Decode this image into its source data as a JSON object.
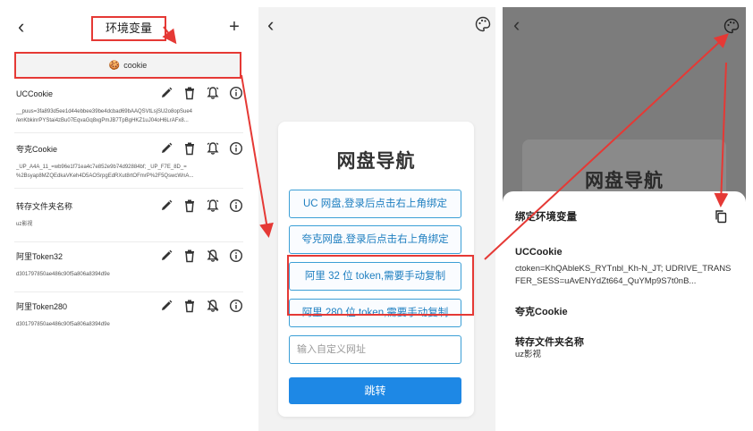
{
  "panel1": {
    "title": "环境变量",
    "back_glyph": "‹",
    "add_glyph": "+",
    "cookie_button": {
      "emoji": "🍪",
      "label": "cookie"
    },
    "items": [
      {
        "name": "UCCookie",
        "value1": "__puus=3fa893d5ee1d44ebbee39be4dcbad69bAAQSVtLsjSU2o8opSue4",
        "value2": "/enKbkinrPYStai4zBu07EqvaGq8xgPmJB7TpBgHKZ1uJ04oH6LrAFx8...",
        "bell": "on"
      },
      {
        "name": "夸克Cookie",
        "value1": "_UP_A4A_11_=wb96e1f71ea4c7e852e9b74d92884bf; _UP_F7E_8D_=",
        "value2": "%2Bsyap8MZQEdkaVKeh4D5AOSrpgEdRXut8rtOFmrP%2F5QswcWnA...",
        "bell": "on"
      },
      {
        "name": "转存文件夹名称",
        "value1": "uz影视",
        "value2": "",
        "bell": "on"
      },
      {
        "name": "阿里Token32",
        "value1": "d301797850ae486c90f5a806a8394d9e",
        "value2": "",
        "bell": "off"
      },
      {
        "name": "阿里Token280",
        "value1": "d301797850ae486c90f5a806a8394d9e",
        "value2": "",
        "bell": "off"
      }
    ]
  },
  "panel2": {
    "back_glyph": "‹",
    "title": "网盘导航",
    "buttons": [
      "UC 网盘,登录后点击右上角绑定",
      "夸克网盘,登录后点击右上角绑定",
      "阿里 32 位 token,需要手动复制",
      "阿里 280 位 token,需要手动复制"
    ],
    "url_placeholder": "输入自定义网址",
    "go_label": "跳转"
  },
  "panel3": {
    "back_glyph": "‹",
    "bg_title": "网盘导航",
    "sheet_title": "绑定环境变量",
    "items": [
      {
        "name": "UCCookie",
        "value": "ctoken=KhQAbleKS_RYTnbl_Kh-N_JT; UDRIVE_TRANSFER_SESS=uAvENYdZt664_QuYMp9S7t0nB..."
      },
      {
        "name": "夸克Cookie",
        "value": ""
      },
      {
        "name": "转存文件夹名称",
        "value": "uz影视"
      }
    ]
  },
  "colors": {
    "annotation": "#e53935",
    "link": "#1f7fc0",
    "primary": "#1e88e5"
  }
}
